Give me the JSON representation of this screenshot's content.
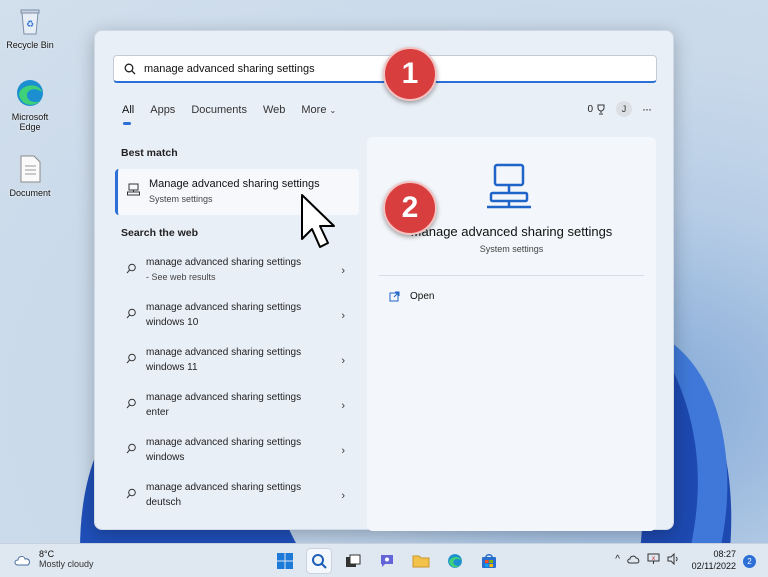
{
  "desktop": {
    "icons": [
      {
        "label": "Recycle Bin",
        "icon": "recycle-bin-icon"
      },
      {
        "label": "Microsoft Edge",
        "icon": "edge-icon"
      },
      {
        "label": "Document",
        "icon": "document-icon"
      }
    ]
  },
  "search": {
    "value": "manage advanced sharing settings",
    "icon": "search-icon"
  },
  "tabs": [
    "All",
    "Apps",
    "Documents",
    "Web",
    "More"
  ],
  "tabs_right": {
    "points": "0",
    "avatar": "J",
    "more": "···"
  },
  "best_match": {
    "heading": "Best match",
    "title": "Manage advanced sharing settings",
    "subtitle": "System settings"
  },
  "web": {
    "heading": "Search the web",
    "items": [
      {
        "line1": "manage advanced sharing settings",
        "line2": "- See web results"
      },
      {
        "line1": "manage advanced sharing settings",
        "line2": "windows 10"
      },
      {
        "line1": "manage advanced sharing settings",
        "line2": "windows 11"
      },
      {
        "line1": "manage advanced sharing settings",
        "line2": "enter"
      },
      {
        "line1": "manage advanced sharing settings",
        "line2": "windows"
      },
      {
        "line1": "manage advanced sharing settings",
        "line2": "deutsch"
      }
    ]
  },
  "detail": {
    "title": "Manage advanced sharing settings",
    "subtitle": "System settings",
    "open_label": "Open"
  },
  "annotations": {
    "badge1": "1",
    "badge2": "2"
  },
  "taskbar": {
    "temperature": "8°C",
    "condition": "Mostly cloudy",
    "time": "08:27",
    "date": "02/11/2022",
    "notifications": "2"
  },
  "colors": {
    "accent": "#2c6fd6",
    "badge": "#d93e3e"
  }
}
